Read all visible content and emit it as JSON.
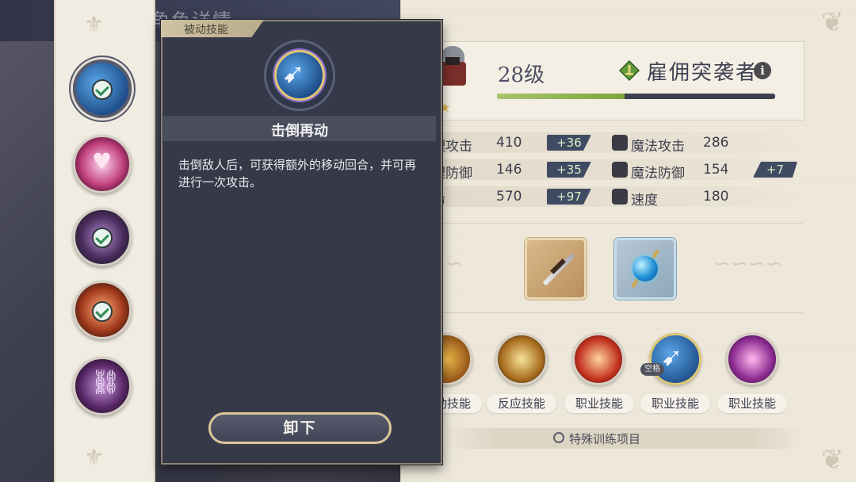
{
  "header": {
    "title": "角色详情"
  },
  "character": {
    "level": "28级",
    "class_name": "雇佣突袭者",
    "info": "i",
    "xp_fraction": 0.46
  },
  "stats": [
    {
      "label": "物理攻击",
      "value": "410",
      "bonus": "+36"
    },
    {
      "label": "魔法攻击",
      "value": "286",
      "bonus": ""
    },
    {
      "label": "物理防御",
      "value": "146",
      "bonus": "+35"
    },
    {
      "label": "魔法防御",
      "value": "154",
      "bonus": "+7"
    },
    {
      "label": "生命",
      "value": "570",
      "bonus": "+97"
    },
    {
      "label": "速度",
      "value": "180",
      "bonus": ""
    }
  ],
  "equipment": [
    {
      "name": "sword"
    },
    {
      "name": "orb-staff"
    }
  ],
  "skills": [
    {
      "label": "主动技能",
      "icon": "slash-icon"
    },
    {
      "label": "反应技能",
      "icon": "shield-icon"
    },
    {
      "label": "职业技能",
      "icon": "flame-icon"
    },
    {
      "label": "职业技能",
      "icon": "runner-icon",
      "tag": "空格"
    },
    {
      "label": "职业技能",
      "icon": "burst-icon"
    }
  ],
  "special_training": "特殊训练项目",
  "sidebar": {
    "items": [
      {
        "icon": "runner-icon",
        "checked": true,
        "selected": true
      },
      {
        "icon": "heart-icon",
        "checked": false,
        "selected": false
      },
      {
        "icon": "vortex-icon",
        "checked": true,
        "selected": false
      },
      {
        "icon": "flame-icon",
        "checked": true,
        "selected": false
      },
      {
        "icon": "chain-icon",
        "checked": false,
        "selected": false
      }
    ]
  },
  "popup": {
    "tab": "被动技能",
    "title": "击倒再动",
    "description": "击倒敌人后，可获得额外的移动回合，并可再进行一次攻击。",
    "unequip": "卸下"
  },
  "colors": {
    "accent_gold": "#d8c89a",
    "bonus_green": "#d9f0c7",
    "panel_dark": "#363947"
  }
}
